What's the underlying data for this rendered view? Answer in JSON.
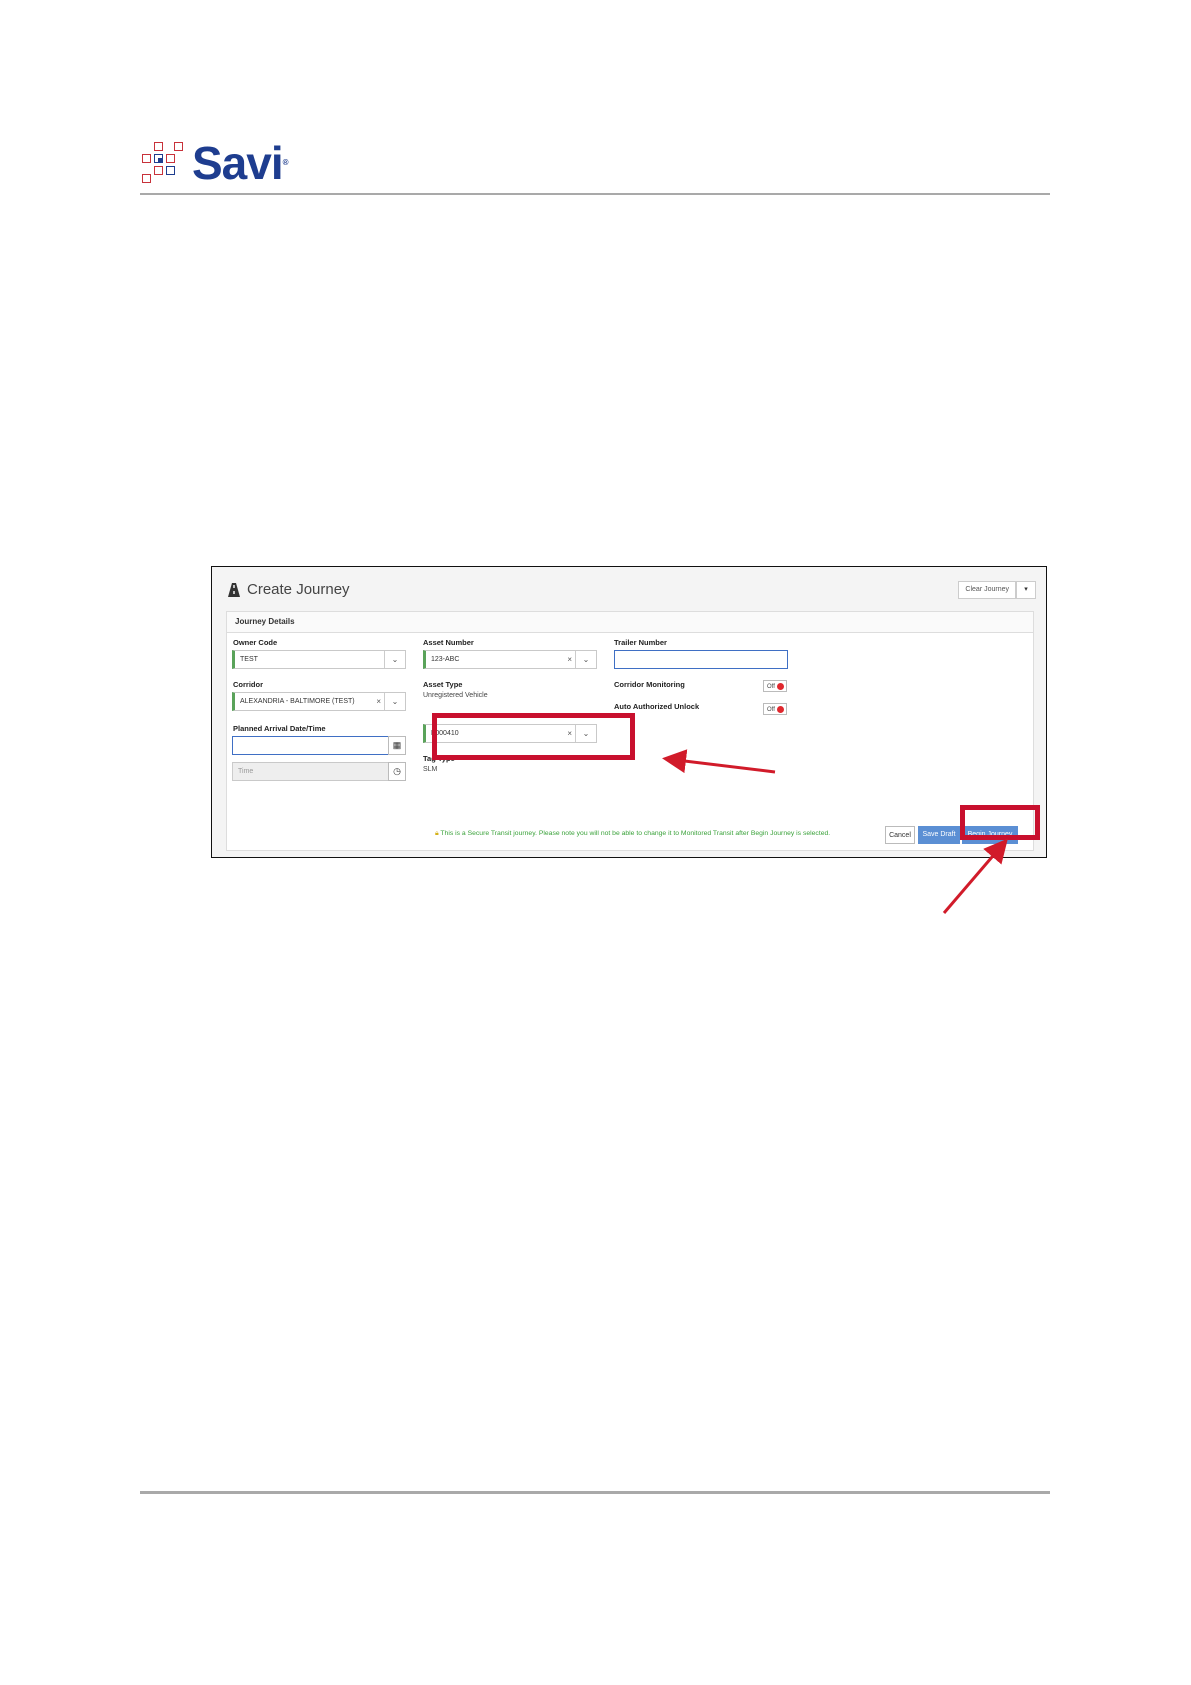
{
  "brand": {
    "name": "Savi",
    "mark": "®"
  },
  "screen": {
    "title": "Create Journey",
    "clear_button": "Clear Journey",
    "section": "Journey Details",
    "owner_code": {
      "label": "Owner Code",
      "value": "TEST"
    },
    "corridor": {
      "label": "Corridor",
      "value": "ALEXANDRIA - BALTIMORE (TEST)"
    },
    "planned_arrival": {
      "label": "Planned Arrival Date/Time",
      "time_placeholder": "Time"
    },
    "asset_number": {
      "label": "Asset Number",
      "value": "123-ABC"
    },
    "asset_type": {
      "label": "Asset Type",
      "value": "Unregistered Vehicle"
    },
    "tag_field": {
      "value": "F000410"
    },
    "tag_type": {
      "label": "Tag Type",
      "value": "SLM"
    },
    "trailer_number": {
      "label": "Trailer Number"
    },
    "corridor_monitoring": {
      "label": "Corridor Monitoring",
      "state": "Off"
    },
    "auto_unlock": {
      "label": "Auto Authorized Unlock",
      "state": "Off"
    },
    "notice": "This is a Secure Transit journey. Please note you will not be able to change it to Monitored Transit after Begin Journey is selected.",
    "cancel_button": "Cancel",
    "save_button": "Save Draft",
    "begin_button": "Begin Journey"
  },
  "colors": {
    "brand_blue": "#1e3d8f",
    "brand_red": "#c8323a",
    "highlight": "#c8102e",
    "primary_button": "#5b8fd4",
    "valid_green": "#5aa35a"
  }
}
